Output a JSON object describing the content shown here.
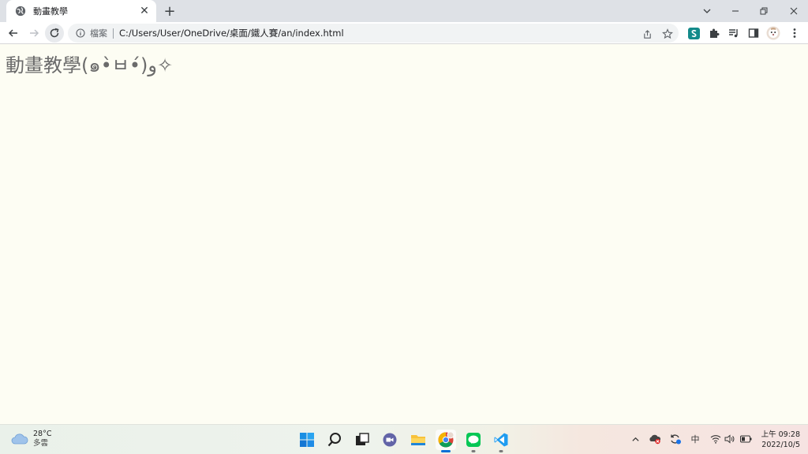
{
  "browser": {
    "tab": {
      "title": "動畫教學",
      "close": "✕"
    },
    "new_tab": "+",
    "address": {
      "info_label": "檔案",
      "url": "C:/Users/User/OneDrive/桌面/鐵人賽/an/index.html"
    }
  },
  "page": {
    "heading": "動畫教學(๑•̀ㅂ•́)و✧"
  },
  "taskbar": {
    "weather": {
      "temp": "28°C",
      "condition": "多雲"
    },
    "input_method": "中",
    "clock": {
      "time": "上午 09:28",
      "date": "2022/10/5"
    }
  },
  "colors": {
    "page_background": "#fdfdf3",
    "heading_text": "#6b6b6b",
    "chrome_frame": "#dee1e6"
  }
}
